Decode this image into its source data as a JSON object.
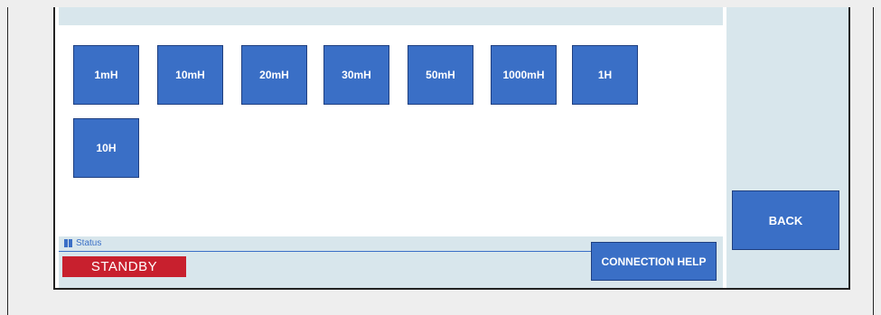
{
  "inductance_buttons": [
    {
      "label": "1mH"
    },
    {
      "label": "10mH"
    },
    {
      "label": "20mH"
    },
    {
      "label": "30mH"
    },
    {
      "label": "50mH"
    },
    {
      "label": "1000mH"
    },
    {
      "label": "1H"
    },
    {
      "label": "10H"
    }
  ],
  "status": {
    "header_label": "Status",
    "value": "STANDBY",
    "value_color": "#c8202e"
  },
  "actions": {
    "connection_help_label": "CONNECTION HELP",
    "back_label": "BACK"
  },
  "colors": {
    "button_fill": "#3a6fc6",
    "panel_bg": "#d8e6ec"
  }
}
